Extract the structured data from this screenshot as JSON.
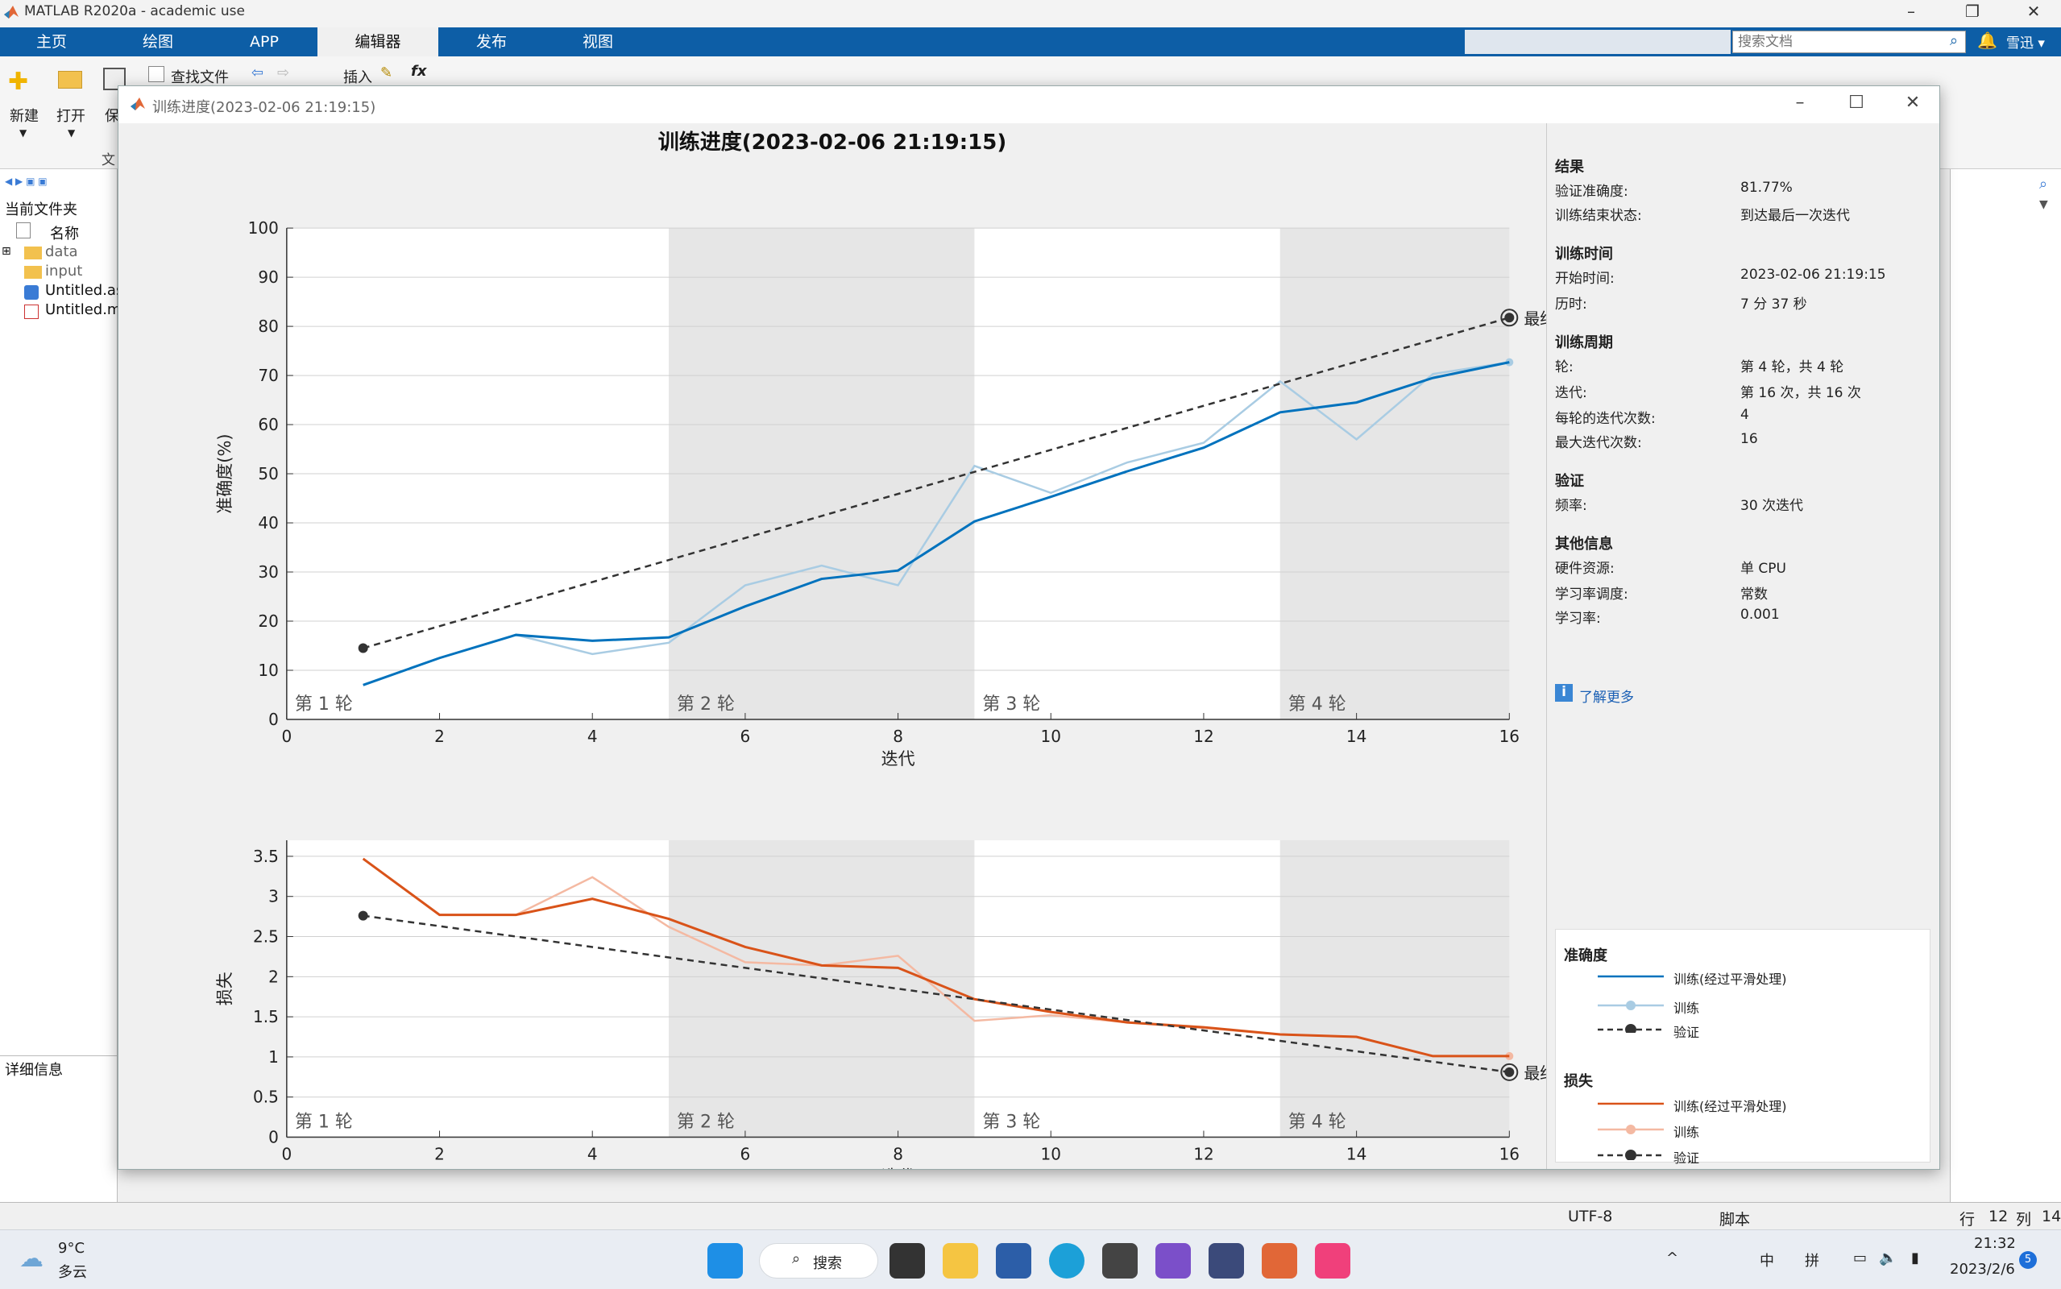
{
  "app": {
    "title": "MATLAB R2020a - academic use",
    "tabs": [
      "主页",
      "绘图",
      "APP",
      "编辑器",
      "发布",
      "视图"
    ],
    "active_tab": "编辑器",
    "search_placeholder": "搜索文档",
    "user": "雪迅 ▾"
  },
  "ribbon": {
    "new_label": "新建",
    "open_label": "打开",
    "save_label": "保",
    "find_file_label": "查找文件",
    "insert_label": "插入",
    "fx_label": "fx",
    "file_group_label": "文"
  },
  "left_panel": {
    "current_folder_label": "当前文件夹",
    "name_header": "名称",
    "files": [
      "data",
      "input",
      "Untitled.as",
      "Untitled.m"
    ],
    "details_label": "详细信息"
  },
  "status_bar": {
    "encoding": "UTF-8",
    "type": "脚本",
    "row_label": "行",
    "row": "12",
    "col_label": "列",
    "col": "14"
  },
  "taskbar": {
    "weather_temp": "9°C",
    "weather_desc": "多云",
    "search_label": "搜索",
    "time": "21:32",
    "date": "2023/2/6",
    "ime_lang": "中",
    "ime_mode": "拼",
    "notifications": "5"
  },
  "dialog": {
    "window_title": "训练进度(2023-02-06 21:19:15)",
    "plot_title": "训练进度(2023-02-06 21:19:15)"
  },
  "side_panel": {
    "results_title": "结果",
    "val_acc_label": "验证准确度:",
    "val_acc": "81.77%",
    "end_state_label": "训练结束状态:",
    "end_state": "到达最后一次迭代",
    "time_title": "训练时间",
    "start_label": "开始时间:",
    "start": "2023-02-06 21:19:15",
    "elapsed_label": "历时:",
    "elapsed": "7 分 37 秒",
    "cycle_title": "训练周期",
    "epoch_label": "轮:",
    "epoch": "第 4 轮，共 4 轮",
    "iter_label": "迭代:",
    "iter": "第 16 次，共 16 次",
    "iter_per_epoch_label": "每轮的迭代次数:",
    "iter_per_epoch": "4",
    "max_iter_label": "最大迭代次数:",
    "max_iter": "16",
    "val_title": "验证",
    "freq_label": "频率:",
    "freq": "30 次迭代",
    "other_title": "其他信息",
    "hw_label": "硬件资源:",
    "hw": "单 CPU",
    "lr_sched_label": "学习率调度:",
    "lr_sched": "常数",
    "lr_label": "学习率:",
    "lr": "0.001",
    "learn_more": "了解更多",
    "legend_acc_title": "准确度",
    "legend_loss_title": "损失",
    "legend_smoothed": "训练(经过平滑处理)",
    "legend_train": "训练",
    "legend_val": "验证"
  },
  "chart_data": [
    {
      "type": "line",
      "ylabel": "准确度(%)",
      "xlabel": "迭代",
      "xlim": [
        0,
        16
      ],
      "ylim": [
        0,
        100
      ],
      "xticks": [
        0,
        2,
        4,
        6,
        8,
        10,
        12,
        14,
        16
      ],
      "yticks": [
        0,
        10,
        20,
        30,
        40,
        50,
        60,
        70,
        80,
        90,
        100
      ],
      "epochs": [
        "第 1 轮",
        "第 2 轮",
        "第 3 轮",
        "第 4 轮"
      ],
      "final_label": "最终",
      "series": [
        {
          "name": "训练(经过平滑处理)",
          "color": "#0072bd",
          "x": [
            1,
            2,
            3,
            4,
            5,
            6,
            7,
            8,
            9,
            10,
            11,
            12,
            13,
            14,
            15,
            16
          ],
          "values": [
            7,
            12.5,
            17.2,
            16,
            16.7,
            23,
            28.6,
            30.3,
            40.3,
            45.3,
            50.5,
            55.3,
            62.5,
            64.5,
            69.5,
            72.7
          ]
        },
        {
          "name": "训练",
          "color": "#a9cce3",
          "x": [
            1,
            2,
            3,
            4,
            5,
            6,
            7,
            8,
            9,
            10,
            11,
            12,
            13,
            14,
            15,
            16
          ],
          "values": [
            7,
            12.5,
            17.2,
            13.3,
            15.6,
            27.3,
            31.3,
            27.3,
            51.6,
            46.1,
            52.3,
            56.3,
            68.8,
            57.0,
            70.3,
            72.7
          ]
        },
        {
          "name": "验证",
          "color": "#333333",
          "x": [
            1,
            16
          ],
          "values": [
            14.5,
            81.77
          ]
        }
      ]
    },
    {
      "type": "line",
      "ylabel": "损失",
      "xlabel": "迭代",
      "xlim": [
        0,
        16
      ],
      "ylim": [
        0,
        3.7
      ],
      "xticks": [
        0,
        2,
        4,
        6,
        8,
        10,
        12,
        14,
        16
      ],
      "yticks": [
        0,
        0.5,
        1,
        1.5,
        2,
        2.5,
        3,
        3.5
      ],
      "epochs": [
        "第 1 轮",
        "第 2 轮",
        "第 3 轮",
        "第 4 轮"
      ],
      "final_label": "最终",
      "series": [
        {
          "name": "训练(经过平滑处理)",
          "color": "#d95319",
          "x": [
            1,
            2,
            3,
            4,
            5,
            6,
            7,
            8,
            9,
            10,
            11,
            12,
            13,
            14,
            15,
            16
          ],
          "values": [
            3.47,
            2.77,
            2.77,
            2.97,
            2.72,
            2.37,
            2.14,
            2.11,
            1.72,
            1.56,
            1.43,
            1.37,
            1.28,
            1.25,
            1.01,
            1.01
          ]
        },
        {
          "name": "训练",
          "color": "#f4b9a2",
          "x": [
            1,
            2,
            3,
            4,
            5,
            6,
            7,
            8,
            9,
            10,
            11,
            12,
            13,
            14,
            15,
            16
          ],
          "values": [
            3.47,
            2.77,
            2.77,
            3.24,
            2.62,
            2.18,
            2.14,
            2.26,
            1.45,
            1.52,
            1.43,
            1.36,
            1.28,
            1.25,
            1.01,
            1.01
          ]
        },
        {
          "name": "验证",
          "color": "#333333",
          "x": [
            1,
            16
          ],
          "values": [
            2.76,
            0.81
          ]
        }
      ]
    }
  ]
}
